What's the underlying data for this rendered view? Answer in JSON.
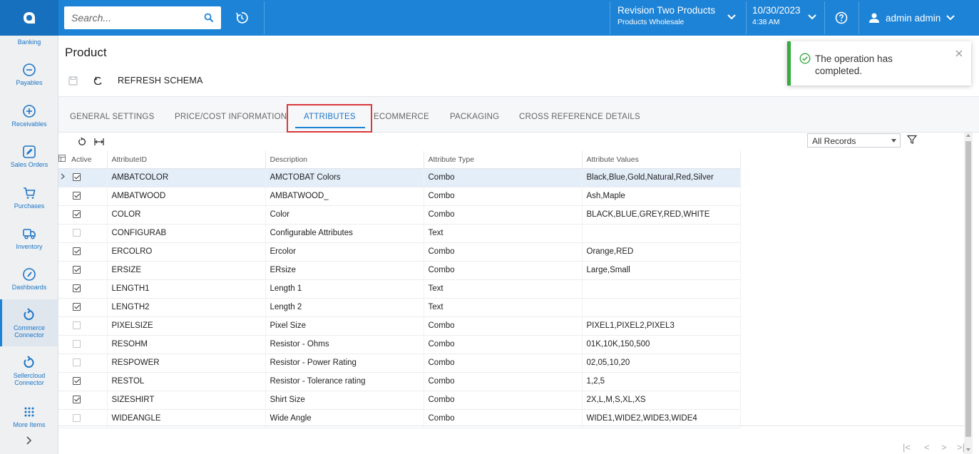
{
  "topbar": {
    "search_placeholder": "Search...",
    "company_name": "Revision Two Products",
    "company_branch": "Products Wholesale",
    "date": "10/30/2023",
    "time": "4:38 AM",
    "user_name": "admin admin"
  },
  "sidebar": {
    "items": [
      {
        "label": "Banking",
        "icon": "banking-icon"
      },
      {
        "label": "Payables",
        "icon": "minus-circle-icon"
      },
      {
        "label": "Receivables",
        "icon": "plus-circle-icon"
      },
      {
        "label": "Sales Orders",
        "icon": "pencil-icon"
      },
      {
        "label": "Purchases",
        "icon": "cart-icon"
      },
      {
        "label": "Inventory",
        "icon": "truck-icon"
      },
      {
        "label": "Dashboards",
        "icon": "gauge-icon"
      },
      {
        "label": "Commerce Connector",
        "icon": "sync-icon"
      },
      {
        "label": "Sellercloud Connector",
        "icon": "sync-icon"
      },
      {
        "label": "More Items",
        "icon": "grid-dots-icon"
      }
    ]
  },
  "page": {
    "title": "Product",
    "refresh_schema": "REFRESH SCHEMA"
  },
  "notification": {
    "message": "The operation has completed."
  },
  "tabs": [
    {
      "label": "GENERAL SETTINGS",
      "active": false
    },
    {
      "label": "PRICE/COST INFORMATION",
      "active": false
    },
    {
      "label": "ATTRIBUTES",
      "active": true
    },
    {
      "label": "ECOMMERCE",
      "active": false
    },
    {
      "label": "PACKAGING",
      "active": false
    },
    {
      "label": "CROSS REFERENCE DETAILS",
      "active": false
    }
  ],
  "grid_toolbar": {
    "records_filter": "All Records"
  },
  "table": {
    "columns": [
      "Active",
      "AttributeID",
      "Description",
      "Attribute Type",
      "Attribute Values"
    ],
    "rows": [
      {
        "active": true,
        "id": "AMBATCOLOR",
        "description": "AMCTOBAT Colors",
        "type": "Combo",
        "values": "Black,Blue,Gold,Natural,Red,Silver",
        "selected": true
      },
      {
        "active": true,
        "id": "AMBATWOOD",
        "description": "AMBATWOOD_",
        "type": "Combo",
        "values": "Ash,Maple"
      },
      {
        "active": true,
        "id": "COLOR",
        "description": "Color",
        "type": "Combo",
        "values": "BLACK,BLUE,GREY,RED,WHITE"
      },
      {
        "active": false,
        "id": "CONFIGURAB",
        "description": "Configurable Attributes",
        "type": "Text",
        "values": ""
      },
      {
        "active": true,
        "id": "ERCOLRO",
        "description": "Ercolor",
        "type": "Combo",
        "values": "Orange,RED"
      },
      {
        "active": true,
        "id": "ERSIZE",
        "description": "ERsize",
        "type": "Combo",
        "values": "Large,Small"
      },
      {
        "active": true,
        "id": "LENGTH1",
        "description": "Length 1",
        "type": "Text",
        "values": ""
      },
      {
        "active": true,
        "id": "LENGTH2",
        "description": "Length 2",
        "type": "Text",
        "values": ""
      },
      {
        "active": false,
        "id": "PIXELSIZE",
        "description": "Pixel Size",
        "type": "Combo",
        "values": "PIXEL1,PIXEL2,PIXEL3"
      },
      {
        "active": false,
        "id": "RESOHM",
        "description": "Resistor - Ohms",
        "type": "Combo",
        "values": "01K,10K,150,500"
      },
      {
        "active": false,
        "id": "RESPOWER",
        "description": "Resistor - Power Rating",
        "type": "Combo",
        "values": "02,05,10,20"
      },
      {
        "active": true,
        "id": "RESTOL",
        "description": "Resistor - Tolerance rating",
        "type": "Combo",
        "values": "1,2,5"
      },
      {
        "active": true,
        "id": "SIZESHIRT",
        "description": "Shirt Size",
        "type": "Combo",
        "values": "2X,L,M,S,XL,XS"
      },
      {
        "active": false,
        "id": "WIDEANGLE",
        "description": "Wide Angle",
        "type": "Combo",
        "values": "WIDE1,WIDE2,WIDE3,WIDE4"
      }
    ]
  },
  "pager": {
    "first": "|<",
    "prev": "<",
    "next": ">",
    "last": ">|"
  },
  "colors": {
    "topbar": "#1d83d6",
    "accent": "#1d75c6",
    "tab_highlight": "#d9383c",
    "success": "#36a93f"
  }
}
